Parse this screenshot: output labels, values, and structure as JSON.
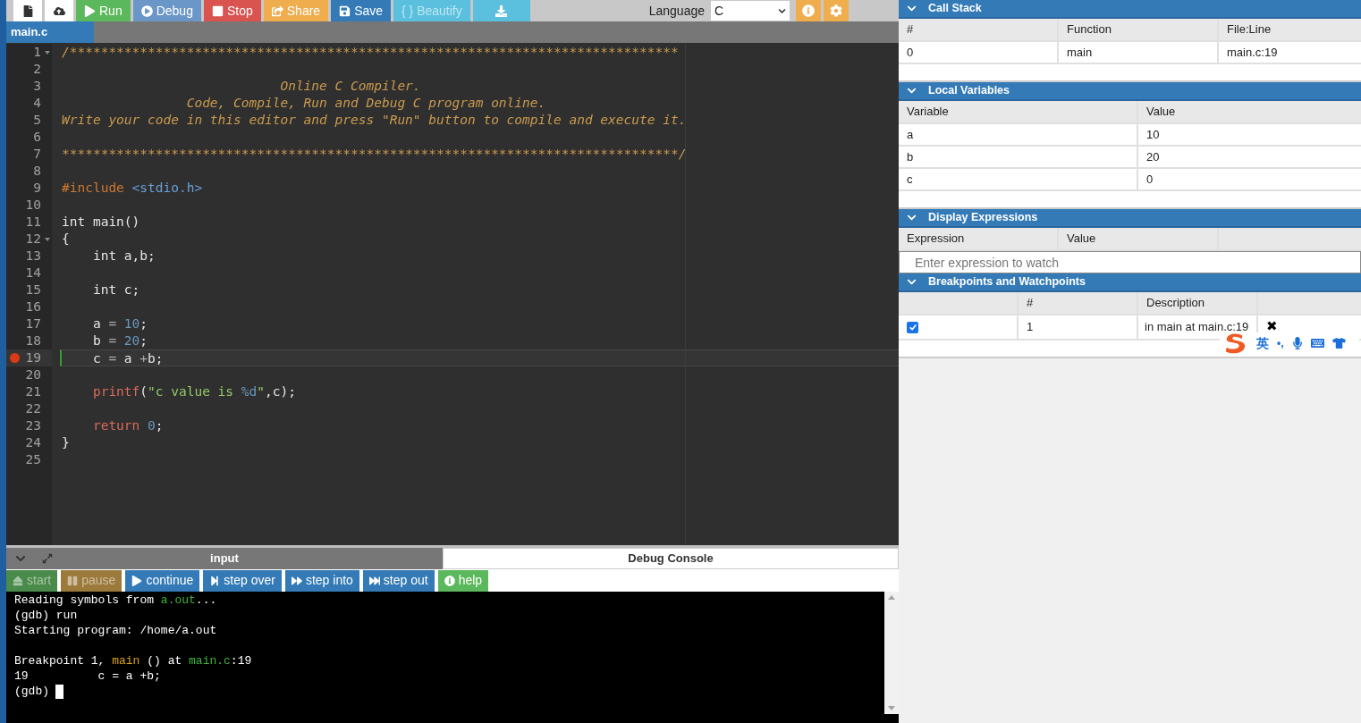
{
  "toolbar": {
    "buttons": [
      {
        "kind": "icon"
      },
      {
        "kind": "icon"
      },
      {
        "kind": "action",
        "label": "Run",
        "color": "#5cb85c",
        "disabled": false
      },
      {
        "kind": "action",
        "label": "Debug",
        "color": "#6b96c8",
        "disabled": false
      },
      {
        "kind": "action",
        "label": "Stop",
        "color": "#d9534f",
        "disabled": false
      },
      {
        "kind": "action",
        "label": "Share",
        "color": "#f0ad4e",
        "disabled": false
      },
      {
        "kind": "action",
        "label": "Save",
        "color": "#337ab7",
        "disabled": false
      },
      {
        "kind": "action",
        "label": "{ } Beautify",
        "color": "#5bc0de",
        "disabled": true
      },
      {
        "kind": "action",
        "color": "#5bc0de",
        "disabled": false
      }
    ],
    "language_label": "Language",
    "language": "C"
  },
  "file_tabs": [
    {
      "label": "main.c",
      "selected": true
    }
  ],
  "code": {
    "lines": [
      {
        "number": "1",
        "fold": true,
        "breakpoint": false,
        "tokens": [
          {
            "kind": "comment",
            "text": "/******************************************************************************"
          }
        ]
      },
      {
        "number": "2",
        "fold": false,
        "breakpoint": false
      },
      {
        "number": "3",
        "fold": false,
        "breakpoint": false,
        "tokens": [
          {
            "kind": "comment",
            "text": "                            Online C Compiler."
          }
        ]
      },
      {
        "number": "4",
        "fold": false,
        "breakpoint": false,
        "tokens": [
          {
            "kind": "comment",
            "text": "                Code, Compile, Run and Debug C program online."
          }
        ]
      },
      {
        "number": "5",
        "fold": false,
        "breakpoint": false,
        "tokens": [
          {
            "kind": "comment",
            "text": "Write your code in this editor and press \"Run\" button to compile and execute it."
          }
        ]
      },
      {
        "number": "6",
        "fold": false,
        "breakpoint": false
      },
      {
        "number": "7",
        "fold": false,
        "breakpoint": false,
        "tokens": [
          {
            "kind": "comment",
            "text": "*******************************************************************************/"
          }
        ]
      },
      {
        "number": "8",
        "fold": false,
        "breakpoint": false
      },
      {
        "number": "9",
        "fold": false,
        "breakpoint": false,
        "tokens": [
          {
            "kind": "directive",
            "text": "#include"
          },
          {
            "kind": "header",
            "text": " <stdio.h>"
          }
        ]
      },
      {
        "number": "10",
        "fold": false,
        "breakpoint": false
      },
      {
        "number": "11",
        "fold": false,
        "breakpoint": false,
        "tokens": [
          {
            "kind": "plain",
            "text": "int main()"
          }
        ]
      },
      {
        "number": "12",
        "fold": true,
        "breakpoint": false,
        "tokens": [
          {
            "kind": "plain",
            "text": "{"
          }
        ]
      },
      {
        "number": "13",
        "fold": false,
        "breakpoint": false,
        "tokens": [
          {
            "kind": "plain",
            "text": "    int a,b;"
          }
        ]
      },
      {
        "number": "14",
        "fold": false,
        "breakpoint": false
      },
      {
        "number": "15",
        "fold": false,
        "breakpoint": false,
        "tokens": [
          {
            "kind": "plain",
            "text": "    int c;"
          }
        ]
      },
      {
        "number": "16",
        "fold": false,
        "breakpoint": false
      },
      {
        "number": "17",
        "fold": false,
        "breakpoint": false,
        "tokens": [
          {
            "kind": "plain",
            "text": "    a "
          },
          {
            "kind": "op",
            "text": "= "
          },
          {
            "kind": "number",
            "text": "10"
          },
          {
            "kind": "plain",
            "text": ";"
          }
        ]
      },
      {
        "number": "18",
        "fold": false,
        "breakpoint": false,
        "tokens": [
          {
            "kind": "plain",
            "text": "    b "
          },
          {
            "kind": "op",
            "text": "= "
          },
          {
            "kind": "number",
            "text": "20"
          },
          {
            "kind": "plain",
            "text": ";"
          }
        ]
      },
      {
        "number": "19",
        "fold": false,
        "breakpoint": true,
        "tokens": [
          {
            "kind": "plain",
            "text": "    c "
          },
          {
            "kind": "op",
            "text": "="
          },
          {
            "kind": "plain",
            "text": " a "
          },
          {
            "kind": "op",
            "text": "+"
          },
          {
            "kind": "plain",
            "text": "b;"
          }
        ]
      },
      {
        "number": "20",
        "fold": false,
        "breakpoint": false
      },
      {
        "number": "21",
        "fold": false,
        "breakpoint": false,
        "tokens": [
          {
            "kind": "func",
            "text": "    printf"
          },
          {
            "kind": "plain",
            "text": "("
          },
          {
            "kind": "string",
            "text": "\"c value is "
          },
          {
            "kind": "number",
            "text": "%d"
          },
          {
            "kind": "string",
            "text": "\""
          },
          {
            "kind": "plain",
            "text": ",c);"
          }
        ]
      },
      {
        "number": "22",
        "fold": false,
        "breakpoint": false
      },
      {
        "number": "23",
        "fold": false,
        "breakpoint": false,
        "tokens": [
          {
            "kind": "func",
            "text": "    return "
          },
          {
            "kind": "number",
            "text": "0"
          },
          {
            "kind": "plain",
            "text": ";"
          }
        ]
      },
      {
        "number": "24",
        "fold": false,
        "breakpoint": false,
        "tokens": [
          {
            "kind": "plain",
            "text": "}"
          }
        ]
      },
      {
        "number": "25",
        "fold": false,
        "breakpoint": false
      }
    ]
  },
  "bottom_tabs": [
    {
      "label": "input",
      "selected": false
    },
    {
      "label": "Debug Console",
      "selected": true
    }
  ],
  "debug_buttons": [
    {
      "label": "start",
      "color": "#4a8a4a",
      "disabled": true
    },
    {
      "label": "pause",
      "color": "#9c7a3c",
      "disabled": true
    },
    {
      "label": "continue",
      "color": "#337ab7",
      "disabled": false
    },
    {
      "label": "step over",
      "color": "#337ab7",
      "disabled": false
    },
    {
      "label": "step into",
      "color": "#337ab7",
      "disabled": false
    },
    {
      "label": "step out",
      "color": "#337ab7",
      "disabled": false
    },
    {
      "label": "help",
      "color": "#5cb85c",
      "disabled": false
    }
  ],
  "console": [
    {
      "blank_before": false,
      "cursor": false,
      "segments": [
        {
          "kind": "plain",
          "text": "Reading symbols from "
        },
        {
          "kind": "file",
          "text": "a.out"
        },
        {
          "kind": "plain",
          "text": "..."
        }
      ]
    },
    {
      "blank_before": false,
      "cursor": false,
      "segments": [
        {
          "kind": "plain",
          "text": "(gdb) run"
        }
      ]
    },
    {
      "blank_before": false,
      "cursor": false,
      "segments": [
        {
          "kind": "plain",
          "text": "Starting program: /home/a.out"
        }
      ]
    },
    {
      "blank_before": true,
      "cursor": false,
      "segments": [
        {
          "kind": "plain",
          "text": "Breakpoint 1, "
        },
        {
          "kind": "func",
          "text": "main"
        },
        {
          "kind": "plain",
          "text": " () at "
        },
        {
          "kind": "file",
          "text": "main.c"
        },
        {
          "kind": "plain",
          "text": ":19"
        }
      ]
    },
    {
      "blank_before": false,
      "cursor": false,
      "segments": [
        {
          "kind": "plain",
          "text": "19          c = a +b;"
        }
      ]
    },
    {
      "blank_before": false,
      "cursor": true,
      "segments": [
        {
          "kind": "plain",
          "text": "(gdb)"
        }
      ]
    }
  ],
  "call_stack": {
    "title": "Call Stack",
    "columns": [
      "#",
      "Function",
      "File:Line"
    ],
    "rows": [
      [
        "0",
        "main",
        "main.c:19"
      ]
    ]
  },
  "local_variables": {
    "title": "Local Variables",
    "columns": [
      "Variable",
      "Value"
    ],
    "rows": [
      [
        "a",
        "10"
      ],
      [
        "b",
        "20"
      ],
      [
        "c",
        "0"
      ]
    ]
  },
  "display_expressions": {
    "title": "Display Expressions",
    "columns": [
      "Expression",
      "Value"
    ],
    "placeholder": "Enter expression to watch"
  },
  "breakpoints": {
    "title": "Breakpoints and Watchpoints",
    "columns": [
      "#",
      "Description"
    ],
    "rows": [
      {
        "enabled": true,
        "number": "1",
        "description": "in main at main.c:19",
        "remove": "✖"
      }
    ]
  },
  "ime_bar": {
    "mode": "英",
    "punct": "•,"
  }
}
